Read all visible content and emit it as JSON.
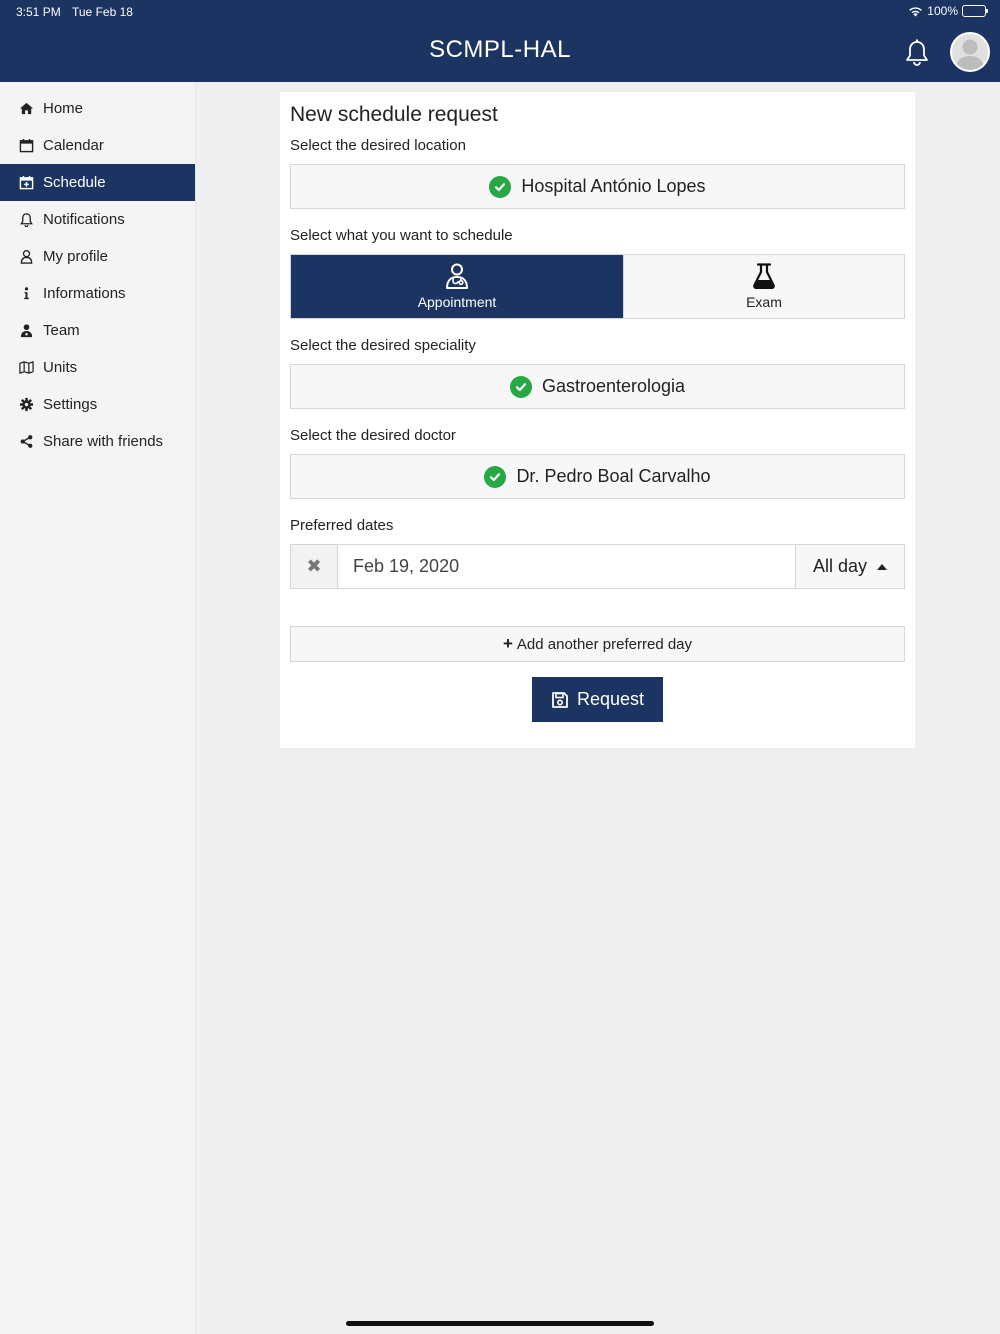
{
  "status_bar": {
    "time": "3:51 PM",
    "date": "Tue Feb 18",
    "battery": "100%"
  },
  "header": {
    "title": "SCMPL-HAL"
  },
  "sidebar": {
    "items": [
      {
        "label": "Home",
        "icon": "home-icon",
        "active": false
      },
      {
        "label": "Calendar",
        "icon": "calendar-icon",
        "active": false
      },
      {
        "label": "Schedule",
        "icon": "calendar-plus-icon",
        "active": true
      },
      {
        "label": "Notifications",
        "icon": "bell-icon",
        "active": false
      },
      {
        "label": "My profile",
        "icon": "user-icon",
        "active": false
      },
      {
        "label": "Informations",
        "icon": "info-icon",
        "active": false
      },
      {
        "label": "Team",
        "icon": "user-md-icon",
        "active": false
      },
      {
        "label": "Units",
        "icon": "map-icon",
        "active": false
      },
      {
        "label": "Settings",
        "icon": "gear-icon",
        "active": false
      },
      {
        "label": "Share with friends",
        "icon": "share-icon",
        "active": false
      }
    ]
  },
  "form": {
    "title": "New schedule request",
    "location": {
      "label": "Select the desired location",
      "value": "Hospital António Lopes"
    },
    "type": {
      "label": "Select what you want to schedule",
      "options": [
        {
          "label": "Appointment",
          "icon": "doctor-icon",
          "selected": true
        },
        {
          "label": "Exam",
          "icon": "flask-icon",
          "selected": false
        }
      ]
    },
    "speciality": {
      "label": "Select the desired speciality",
      "value": "Gastroenterologia"
    },
    "doctor": {
      "label": "Select the desired doctor",
      "value": "Dr. Pedro Boal Carvalho"
    },
    "dates": {
      "label": "Preferred dates",
      "entries": [
        {
          "date": "Feb 19, 2020",
          "period": "All day"
        }
      ],
      "add_label": "Add another preferred day"
    },
    "submit_label": "Request"
  },
  "colors": {
    "primary": "#1b3461",
    "success": "#28a745",
    "background": "#efefef"
  }
}
